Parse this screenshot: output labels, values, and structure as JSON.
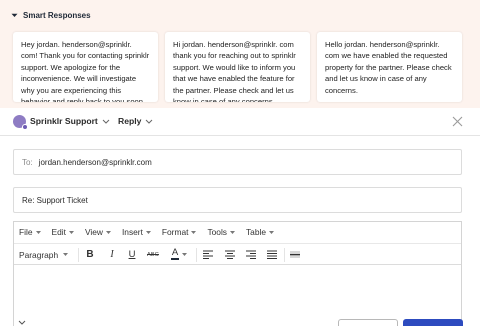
{
  "smart_responses": {
    "title": "Smart Responses",
    "cards": [
      {
        "text": "Hey jordan. henderson@sprinklr. com! Thank you for contacting sprinklr support. We apologize for the inconvenience. We will investigate why you are experiencing this behavior and reply back to you soon."
      },
      {
        "text": "Hi jordan. henderson@sprinklr. com thank you for reaching out to sprinklr support. We would like to inform you that we have enabled the feature for the partner. Please check and let us know in case of any concerns."
      },
      {
        "text": "Hello jordan. henderson@sprinklr. com we have enabled the requested property for the partner. Please check and let us know in case of any concerns."
      }
    ]
  },
  "composer": {
    "account": "Sprinklr Support",
    "mode": "Reply"
  },
  "to_field": {
    "label": "To:",
    "value": "jordan.henderson@sprinklr.com"
  },
  "subject_field": {
    "value": "Re: Support Ticket"
  },
  "editor": {
    "menu": [
      "File",
      "Edit",
      "View",
      "Insert",
      "Format",
      "Tools",
      "Table"
    ],
    "paragraph_label": "Paragraph",
    "bold": "B",
    "italic": "I",
    "underline": "U",
    "strikethrough": "ABC",
    "font_color": "A"
  },
  "colors": {
    "panel_bg": "#fdf3ee",
    "accent": "#2d4bbf",
    "avatar": "#8e7cc3"
  },
  "icons": [
    "chevron-down-icon",
    "close-icon",
    "align-left-icon",
    "align-center-icon",
    "align-right-icon",
    "align-justify-icon",
    "horizontal-rule-icon"
  ]
}
